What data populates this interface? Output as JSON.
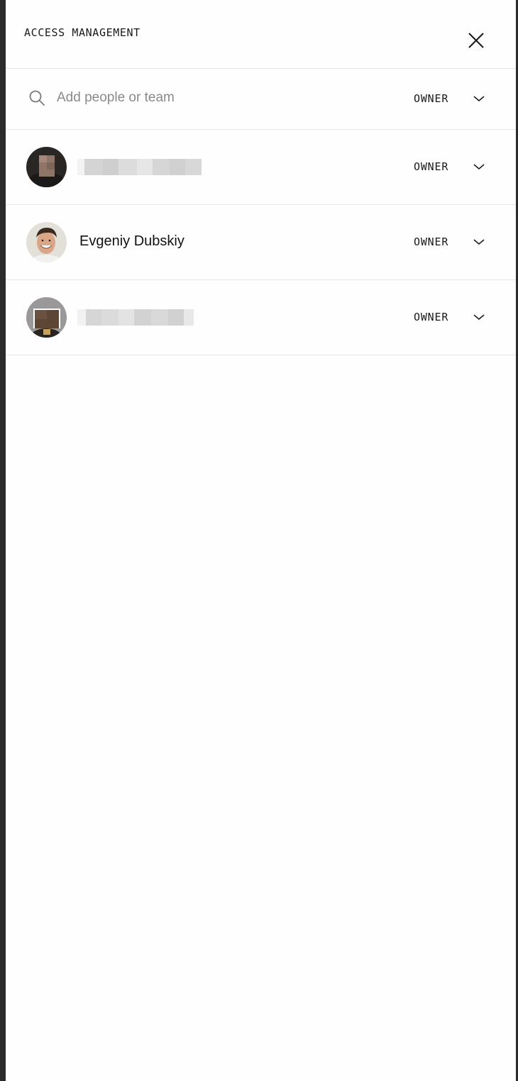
{
  "dialog": {
    "title": "ACCESS MANAGEMENT",
    "close_icon": "close-icon"
  },
  "search": {
    "placeholder": "Add people or team",
    "value": "",
    "icon": "search-icon",
    "role": "OWNER"
  },
  "members": [
    {
      "name": "",
      "name_redacted": true,
      "role": "OWNER",
      "avatar": "avatar-photo-redacted"
    },
    {
      "name": "Evgeniy Dubskiy",
      "name_redacted": false,
      "role": "OWNER",
      "avatar": "avatar-photo"
    },
    {
      "name": "",
      "name_redacted": true,
      "role": "OWNER",
      "avatar": "avatar-photo-redacted"
    }
  ],
  "colors": {
    "panel_background": "#fefefe",
    "page_background": "#2b2b2b",
    "divider": "#e6e6e6",
    "text": "#1a1a1a",
    "placeholder": "#8a8a8a"
  }
}
